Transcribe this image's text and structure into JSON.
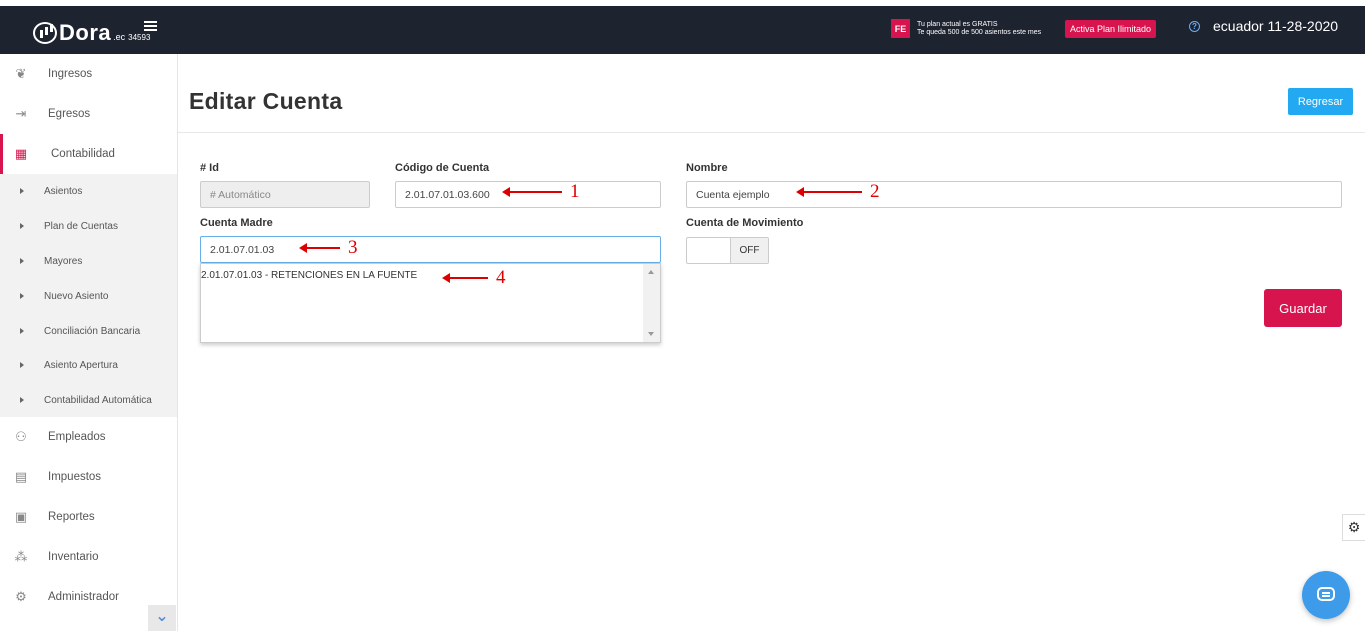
{
  "topbar": {
    "brand_name": "Dora",
    "brand_tld": ".ec",
    "brand_code": "34593",
    "fe_badge": "FE",
    "plan_line1": "Tu plan actual es GRATIS",
    "plan_line2": "Te queda 500 de 500 asientos este mes",
    "plan_button": "Activa Plan Ilimitado",
    "user_info": "ecuador 11-28-2020"
  },
  "sidebar": {
    "items": [
      {
        "label": "Ingresos",
        "icon": "piggy-bank-icon"
      },
      {
        "label": "Egresos",
        "icon": "cash-out-icon"
      },
      {
        "label": "Contabilidad",
        "icon": "calculator-icon"
      },
      {
        "label": "Empleados",
        "icon": "people-icon"
      },
      {
        "label": "Impuestos",
        "icon": "tax-icon"
      },
      {
        "label": "Reportes",
        "icon": "report-icon"
      },
      {
        "label": "Inventario",
        "icon": "boxes-icon"
      },
      {
        "label": "Administrador",
        "icon": "gear-icon"
      }
    ],
    "subitems": [
      "Asientos",
      "Plan de Cuentas",
      "Mayores",
      "Nuevo Asiento",
      "Conciliación Bancaria",
      "Asiento Apertura",
      "Contabilidad Automática"
    ]
  },
  "page": {
    "title": "Editar Cuenta",
    "back_button": "Regresar",
    "save_button": "Guardar"
  },
  "form": {
    "id_label": "# Id",
    "id_placeholder": "# Automático",
    "code_label": "Código de Cuenta",
    "code_value": "2.01.07.01.03.600",
    "name_label": "Nombre",
    "name_value": "Cuenta ejemplo",
    "parent_label": "Cuenta Madre",
    "parent_value": "2.01.07.01.03",
    "movement_label": "Cuenta de Movimiento",
    "movement_toggle": "OFF",
    "dropdown_option": "2.01.07.01.03 - RETENCIONES EN LA FUENTE"
  },
  "annotations": [
    "1",
    "2",
    "3",
    "4"
  ],
  "colors": {
    "topbar": "#1e2330",
    "accent": "#d7144e",
    "primary": "#23a8f2",
    "annotation": "#dd0000"
  }
}
